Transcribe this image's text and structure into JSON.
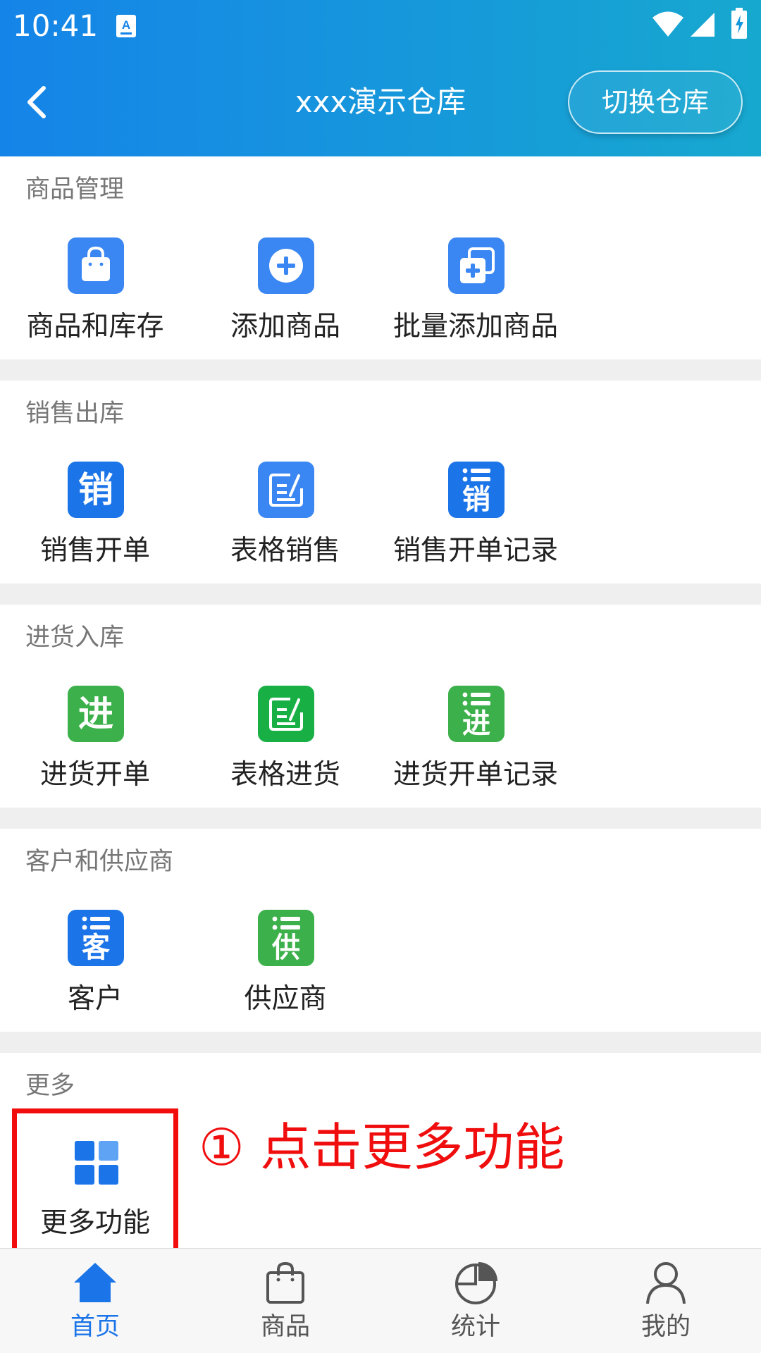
{
  "status_bar": {
    "time": "10:41",
    "icons": [
      "a-notification-icon",
      "wifi-icon",
      "signal-icon",
      "battery-charging-icon"
    ]
  },
  "nav": {
    "title": "xxx演示仓库",
    "switch_label": "切换仓库",
    "back_icon": "chevron-left-icon"
  },
  "sections": {
    "goods": {
      "title": "商品管理",
      "items": [
        {
          "label": "商品和库存",
          "icon": "shopping-bag-icon"
        },
        {
          "label": "添加商品",
          "icon": "plus-circle-icon"
        },
        {
          "label": "批量添加商品",
          "icon": "batch-add-icon"
        }
      ]
    },
    "sales": {
      "title": "销售出库",
      "items": [
        {
          "label": "销售开单",
          "icon": "sales-icon",
          "glyph": "销"
        },
        {
          "label": "表格销售",
          "icon": "table-edit-icon"
        },
        {
          "label": "销售开单记录",
          "icon": "sales-record-icon",
          "glyph": "销"
        }
      ]
    },
    "purchase": {
      "title": "进货入库",
      "items": [
        {
          "label": "进货开单",
          "icon": "purchase-icon",
          "glyph": "进"
        },
        {
          "label": "表格进货",
          "icon": "table-edit-icon"
        },
        {
          "label": "进货开单记录",
          "icon": "purchase-record-icon",
          "glyph": "进"
        }
      ]
    },
    "partners": {
      "title": "客户和供应商",
      "items": [
        {
          "label": "客户",
          "icon": "customer-icon",
          "glyph": "客"
        },
        {
          "label": "供应商",
          "icon": "supplier-icon",
          "glyph": "供"
        }
      ]
    },
    "more": {
      "title": "更多",
      "items": [
        {
          "label": "更多功能",
          "icon": "grid-apps-icon"
        }
      ]
    }
  },
  "annotation": {
    "hint": "① 点击更多功能",
    "color": "#f20d0d"
  },
  "bottom_nav": [
    {
      "label": "首页",
      "icon": "home-icon",
      "active": true
    },
    {
      "label": "商品",
      "icon": "shopping-bag-outline-icon",
      "active": false
    },
    {
      "label": "统计",
      "icon": "pie-chart-icon",
      "active": false
    },
    {
      "label": "我的",
      "icon": "user-icon",
      "active": false
    }
  ],
  "colors": {
    "header_gradient_start": "#1584e8",
    "header_gradient_end": "#17a8cf",
    "accent_blue": "#1b74e8",
    "accent_green": "#3cb04a"
  }
}
